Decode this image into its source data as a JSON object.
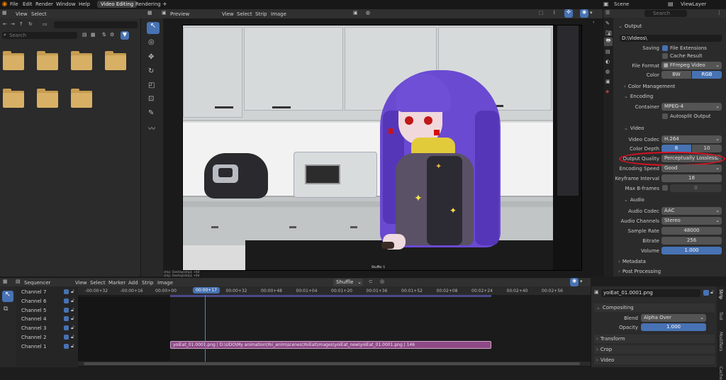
{
  "topbar": {
    "menus": [
      "File",
      "Edit",
      "Render",
      "Window",
      "Help"
    ],
    "workspaces": [
      "Video Editing",
      "Rendering"
    ],
    "add": "+",
    "scene": "Scene",
    "viewlayer": "ViewLayer"
  },
  "filebrowser": {
    "menu": [
      "View",
      "Select"
    ],
    "search_placeholder": "Search",
    "folder_count": 7
  },
  "preview": {
    "title": "Preview",
    "menu": [
      "View",
      "Select",
      "Strip",
      "Image"
    ],
    "overlay_text1": "strip: Overlay(strip); +6d",
    "overlay_text2": "strip: Overlay(strip); +6d",
    "frame_label": "Shuffle: 1"
  },
  "properties": {
    "search_placeholder": "Search",
    "output_header": "Output",
    "path": "D:\\Videos\\",
    "saving_label": "Saving",
    "file_extensions": "File Extensions",
    "cache_result": "Cache Result",
    "file_format_label": "File Format",
    "file_format": "FFmpeg Video",
    "color_label": "Color",
    "color_bw": "BW",
    "color_rgb": "RGB",
    "color_management": "Color Management",
    "encoding": "Encoding",
    "container_label": "Container",
    "container": "MPEG-4",
    "autosplit": "Autosplit Output",
    "video": "Video",
    "video_codec_label": "Video Codec",
    "video_codec": "H.264",
    "color_depth_label": "Color Depth",
    "color_depth_8": "8",
    "color_depth_10": "10",
    "output_quality_label": "Output Quality",
    "output_quality": "Perceptually Lossless",
    "encoding_speed_label": "Encoding Speed",
    "encoding_speed": "Good",
    "keyframe_label": "Keyframe Interval",
    "keyframe": "18",
    "max_bframes_label": "Max B-frames",
    "max_bframes": "0",
    "audio": "Audio",
    "audio_codec_label": "Audio Codec",
    "audio_codec": "AAC",
    "audio_channels_label": "Audio Channels",
    "audio_channels": "Stereo",
    "sample_rate_label": "Sample Rate",
    "sample_rate": "48000",
    "bitrate_label": "Bitrate",
    "bitrate": "256",
    "volume_label": "Volume",
    "volume": "1.000",
    "metadata": "Metadata",
    "post_processing": "Post Processing"
  },
  "sequencer": {
    "editor": "Sequencer",
    "menu": [
      "View",
      "Select",
      "Marker",
      "Add",
      "Strip",
      "Image"
    ],
    "shuffle": "Shuffle",
    "channels": [
      "Channel 7",
      "Channel 6",
      "Channel 5",
      "Channel 4",
      "Channel 3",
      "Channel 2",
      "Channel 1"
    ],
    "timecodes": [
      "-00:00+32",
      "-00:00+16",
      "00:00+00",
      "00:00+17",
      "00:00+32",
      "00:00+48",
      "00:01+04",
      "00:01+20",
      "00:01+36",
      "00:01+52",
      "00:02+08",
      "00:02+24",
      "00:02+40",
      "00:02+56"
    ],
    "current_time": "00:00+17",
    "strip_label": "yoiEat_01.0001.png | D:\\UDO\\My animation\\Yoi_anim\\scenes\\YoiEat\\images\\yoiEat_new\\yoiEat_01.0001.png | 146"
  },
  "strip_panel": {
    "name": "yoiEat_01.0001.png",
    "compositing": "Compositing",
    "blend_label": "Blend",
    "blend": "Alpha Over",
    "opacity_label": "Opacity",
    "opacity": "1.000",
    "transform": "Transform",
    "crop": "Crop",
    "video": "Video",
    "tabs": [
      "Strip",
      "Tool",
      "Modifiers",
      "Cache"
    ]
  },
  "colors": {
    "accent": "#4772b3",
    "highlight": "#e01020",
    "strip": "#8e4a86"
  }
}
